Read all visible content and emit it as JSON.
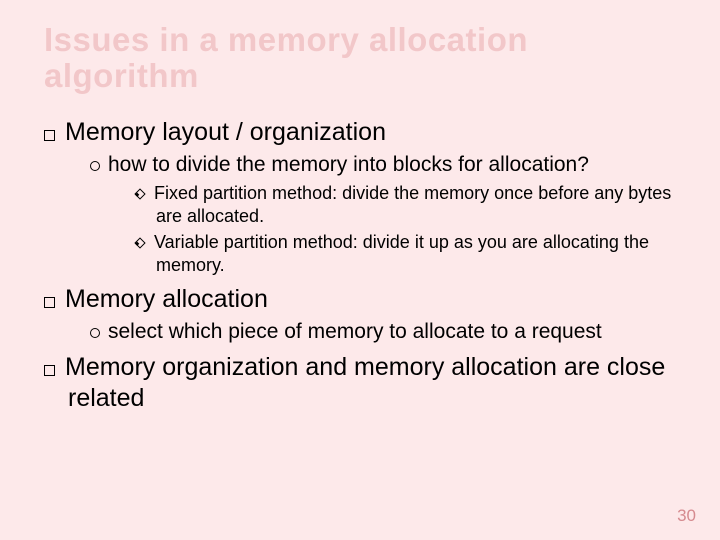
{
  "title": "Issues in a memory allocation algorithm",
  "bullets": [
    {
      "text": "Memory layout / organization",
      "children": [
        {
          "text": "how to divide the memory into blocks for allocation?",
          "children": [
            {
              "text": "Fixed partition method: divide the memory once before any bytes are allocated."
            },
            {
              "text": "Variable partition method: divide it up as you are allocating the memory."
            }
          ]
        }
      ]
    },
    {
      "text": "Memory allocation",
      "children": [
        {
          "text": "select which piece of memory to allocate to a request"
        }
      ]
    },
    {
      "text": "Memory organization and memory allocation are close related"
    }
  ],
  "page_number": "30"
}
